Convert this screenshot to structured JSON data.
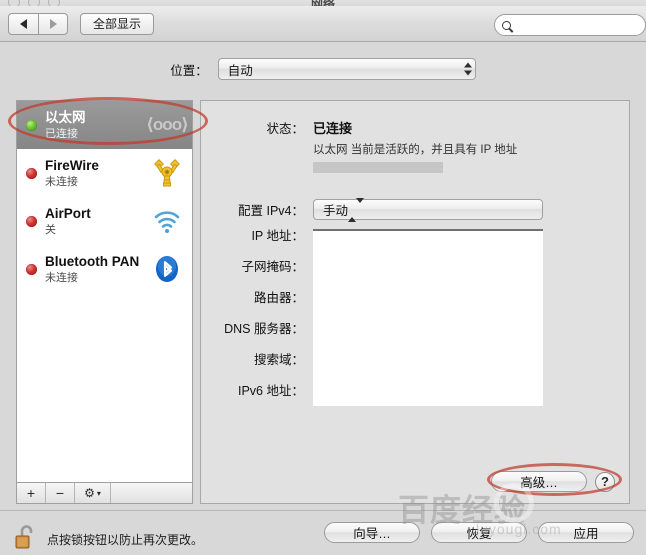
{
  "window": {
    "title": "网络",
    "traffic_lights": [
      "close",
      "minimize",
      "zoom"
    ]
  },
  "toolbar": {
    "back_icon": "triangle-left-icon",
    "forward_icon": "triangle-right-icon",
    "show_all_label": "全部显示",
    "search_placeholder": "",
    "search_value": "",
    "search_icon": "search-icon"
  },
  "location": {
    "label": "位置：",
    "selected": "自动"
  },
  "sidebar": {
    "services": [
      {
        "name": "以太网",
        "status": "已连接",
        "dot": "green",
        "icon": "ethernet-icon",
        "selected": true
      },
      {
        "name": "FireWire",
        "status": "未连接",
        "dot": "red",
        "icon": "firewire-icon",
        "selected": false
      },
      {
        "name": "AirPort",
        "status": "关",
        "dot": "red",
        "icon": "airport-wifi-icon",
        "selected": false
      },
      {
        "name": "Bluetooth PAN",
        "status": "未连接",
        "dot": "red",
        "icon": "bluetooth-icon",
        "selected": false
      }
    ],
    "toolbar": {
      "add_label": "+",
      "remove_label": "−",
      "action_label": "⚙"
    }
  },
  "panel": {
    "status_label": "状态：",
    "status_value": "已连接",
    "status_description": "以太网 当前是活跃的，并且具有 IP 地址",
    "redacted_note": "",
    "configure_label": "配置 IPv4：",
    "configure_value": "手动",
    "fields": [
      {
        "label": "IP 地址：",
        "value": ""
      },
      {
        "label": "子网掩码：",
        "value": ""
      },
      {
        "label": "路由器：",
        "value": ""
      },
      {
        "label": "DNS 服务器：",
        "value": ""
      },
      {
        "label": "搜索域：",
        "value": ""
      },
      {
        "label": "IPv6 地址：",
        "value": ""
      }
    ],
    "advanced_label": "高级…",
    "help_label": "?"
  },
  "footer": {
    "lock_icon": "unlocked-padlock-icon",
    "lock_text": "点按锁按钮以防止再次更改。",
    "assistant_label": "向导…",
    "revert_label": "恢复",
    "apply_label": "应用"
  },
  "watermark": {
    "main_text": "百度经验",
    "sub_text": "luyougi.com"
  },
  "colors": {
    "accent_annotation": "#c0392b",
    "connected": "#6fc635",
    "disconnected": "#d03434",
    "selection": "#8d8d8d"
  }
}
